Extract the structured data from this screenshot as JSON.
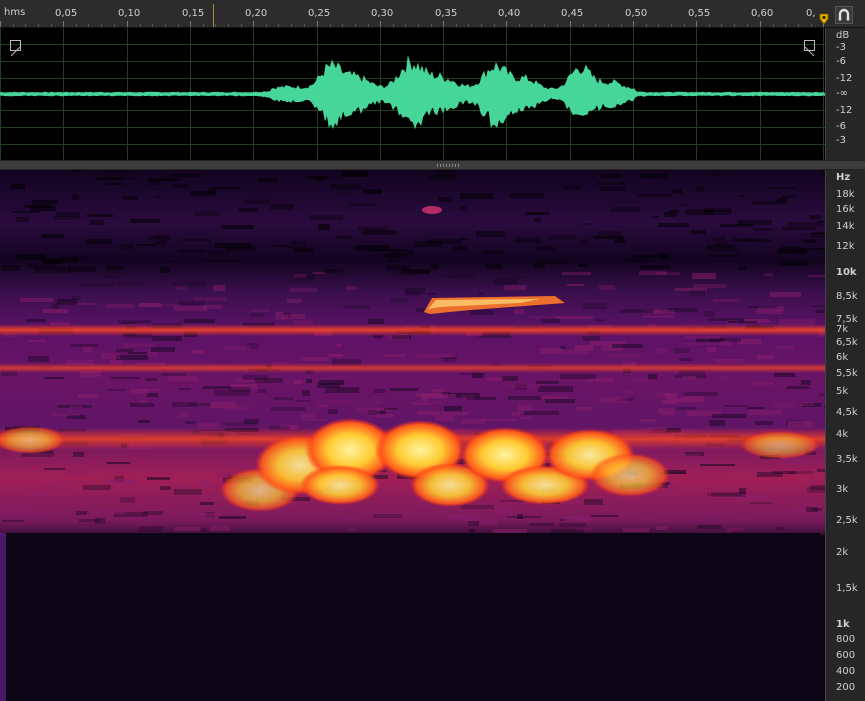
{
  "time_ruler": {
    "unit": "hms",
    "ticks": [
      "0,05",
      "0,10",
      "0,15",
      "0,20",
      "0,25",
      "0,30",
      "0,35",
      "0,40",
      "0,45",
      "0,50",
      "0,55",
      "0,60",
      "0,"
    ]
  },
  "waveform": {
    "db_scale": [
      "dB",
      "-3",
      "-6",
      "-12",
      "-∞",
      "-12",
      "-6",
      "-3"
    ],
    "color": "#46d69a"
  },
  "spectrogram": {
    "freq_scale": [
      "Hz",
      "18k",
      "16k",
      "14k",
      "12k",
      "10k",
      "8,5k",
      "7,5k",
      "7k",
      "6,5k",
      "6k",
      "5,5k",
      "5k",
      "4,5k",
      "4k",
      "3,5k",
      "3k",
      "2,5k",
      "2k",
      "1,5k",
      "1k",
      "800",
      "600",
      "400",
      "200"
    ]
  },
  "colors": {
    "accent": "#46d69a",
    "marker": "#e8b400"
  }
}
